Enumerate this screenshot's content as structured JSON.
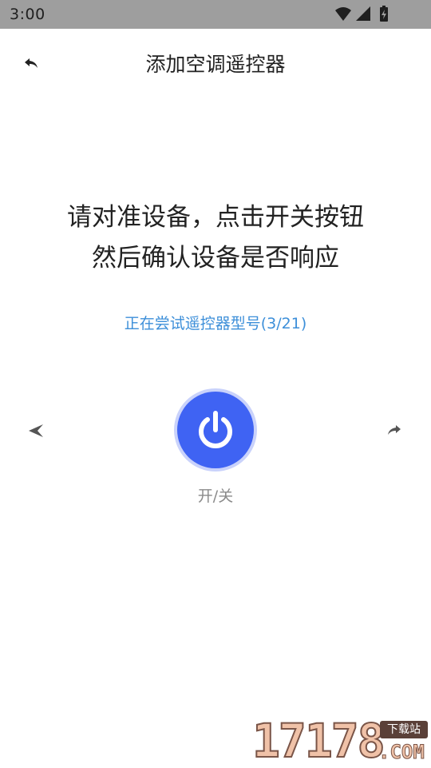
{
  "status_bar": {
    "time": "3:00",
    "icons": [
      "wifi-icon",
      "signal-icon",
      "battery-charging-icon"
    ]
  },
  "toolbar": {
    "back_icon": "back-arrow-icon",
    "title": "添加空调遥控器"
  },
  "instruction": {
    "line1": "请对准设备，点击开关按钮",
    "line2": "然后确认设备是否响应"
  },
  "model_status": "正在尝试遥控器型号(3/21)",
  "controls": {
    "prev_icon": "previous-arrow-icon",
    "next_icon": "next-arrow-icon",
    "power_icon": "power-icon",
    "power_label": "开/关"
  },
  "watermark": {
    "digits": "17178",
    "tag": "下载站",
    "domain": ".COM"
  },
  "colors": {
    "status_bar_bg": "#9e9e9e",
    "accent_blue": "#3f63f3",
    "link_blue": "#3d8fd9",
    "title_text": "#222222",
    "label_gray": "#8a8a8a"
  }
}
